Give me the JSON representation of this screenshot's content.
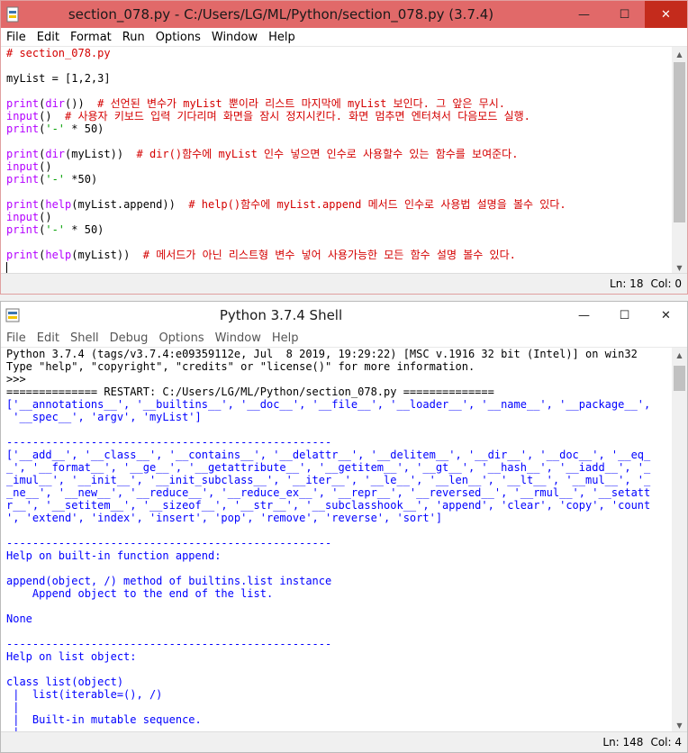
{
  "editor_window": {
    "title": "section_078.py - C:/Users/LG/ML/Python/section_078.py (3.7.4)",
    "menu": [
      "File",
      "Edit",
      "Format",
      "Run",
      "Options",
      "Window",
      "Help"
    ],
    "status": {
      "ln": "Ln: 18",
      "col": "Col: 0"
    },
    "lines": [
      [
        {
          "t": "# section_078.py",
          "c": "red"
        }
      ],
      [],
      [
        {
          "t": "myList = [1,2,3]",
          "c": "dflt"
        }
      ],
      [],
      [
        {
          "t": "print",
          "c": "kw"
        },
        {
          "t": "(",
          "c": "dflt"
        },
        {
          "t": "dir",
          "c": "kw"
        },
        {
          "t": "())  ",
          "c": "dflt"
        },
        {
          "t": "# 선언된 변수가 myList 뿐이라 리스트 마지막에 myList 보인다. 그 앞은 무시.",
          "c": "red"
        }
      ],
      [
        {
          "t": "input",
          "c": "kw"
        },
        {
          "t": "()  ",
          "c": "dflt"
        },
        {
          "t": "# 사용자 키보드 입력 기다리며 화면을 잠시 정지시킨다. 화면 멈추면 엔터쳐서 다음모드 실행.",
          "c": "red"
        }
      ],
      [
        {
          "t": "print",
          "c": "kw"
        },
        {
          "t": "(",
          "c": "dflt"
        },
        {
          "t": "'-'",
          "c": "grn"
        },
        {
          "t": " * 50)",
          "c": "dflt"
        }
      ],
      [],
      [
        {
          "t": "print",
          "c": "kw"
        },
        {
          "t": "(",
          "c": "dflt"
        },
        {
          "t": "dir",
          "c": "kw"
        },
        {
          "t": "(myList))  ",
          "c": "dflt"
        },
        {
          "t": "# dir()함수에 myList 인수 넣으면 인수로 사용할수 있는 함수를 보여준다.",
          "c": "red"
        }
      ],
      [
        {
          "t": "input",
          "c": "kw"
        },
        {
          "t": "()",
          "c": "dflt"
        }
      ],
      [
        {
          "t": "print",
          "c": "kw"
        },
        {
          "t": "(",
          "c": "dflt"
        },
        {
          "t": "'-'",
          "c": "grn"
        },
        {
          "t": " *50)",
          "c": "dflt"
        }
      ],
      [],
      [
        {
          "t": "print",
          "c": "kw"
        },
        {
          "t": "(",
          "c": "dflt"
        },
        {
          "t": "help",
          "c": "kw"
        },
        {
          "t": "(myList.append))  ",
          "c": "dflt"
        },
        {
          "t": "# help()함수에 myList.append 메서드 인수로 사용법 설명을 볼수 있다.",
          "c": "red"
        }
      ],
      [
        {
          "t": "input",
          "c": "kw"
        },
        {
          "t": "()",
          "c": "dflt"
        }
      ],
      [
        {
          "t": "print",
          "c": "kw"
        },
        {
          "t": "(",
          "c": "dflt"
        },
        {
          "t": "'-'",
          "c": "grn"
        },
        {
          "t": " * 50)",
          "c": "dflt"
        }
      ],
      [],
      [
        {
          "t": "print",
          "c": "kw"
        },
        {
          "t": "(",
          "c": "dflt"
        },
        {
          "t": "help",
          "c": "kw"
        },
        {
          "t": "(myList))  ",
          "c": "dflt"
        },
        {
          "t": "# 메서드가 아닌 리스트형 변수 넣어 사용가능한 모든 함수 설명 볼수 있다.",
          "c": "red"
        }
      ],
      [
        {
          "t": "",
          "c": "caret"
        }
      ]
    ]
  },
  "shell_window": {
    "title": "Python 3.7.4 Shell",
    "menu": [
      "File",
      "Edit",
      "Shell",
      "Debug",
      "Options",
      "Window",
      "Help"
    ],
    "status": {
      "ln": "Ln: 148",
      "col": "Col: 4"
    },
    "lines": [
      [
        {
          "t": "Python 3.7.4 (tags/v3.7.4:e09359112e, Jul  8 2019, 19:29:22) [MSC v.1916 32 bit (Intel)] on win32",
          "c": "dflt"
        }
      ],
      [
        {
          "t": "Type \"help\", \"copyright\", \"credits\" or \"license()\" for more information.",
          "c": "dflt"
        }
      ],
      [
        {
          "t": ">>> ",
          "c": "dflt"
        }
      ],
      [
        {
          "t": "============== RESTART: C:/Users/LG/ML/Python/section_078.py ==============",
          "c": "dflt"
        }
      ],
      [
        {
          "t": "['__annotations__', '__builtins__', '__doc__', '__file__', '__loader__', '__name__', '__package__',",
          "c": "blu"
        }
      ],
      [
        {
          "t": " '__spec__', 'argv', 'myList']",
          "c": "blu"
        }
      ],
      [],
      [
        {
          "t": "--------------------------------------------------",
          "c": "blu"
        }
      ],
      [
        {
          "t": "['__add__', '__class__', '__contains__', '__delattr__', '__delitem__', '__dir__', '__doc__', '__eq_",
          "c": "blu"
        }
      ],
      [
        {
          "t": "_', '__format__', '__ge__', '__getattribute__', '__getitem__', '__gt__', '__hash__', '__iadd__', '_",
          "c": "blu"
        }
      ],
      [
        {
          "t": "_imul__', '__init__', '__init_subclass__', '__iter__', '__le__', '__len__', '__lt__', '__mul__', '_",
          "c": "blu"
        }
      ],
      [
        {
          "t": "_ne__', '__new__', '__reduce__', '__reduce_ex__', '__repr__', '__reversed__', '__rmul__', '__setatt",
          "c": "blu"
        }
      ],
      [
        {
          "t": "r__', '__setitem__', '__sizeof__', '__str__', '__subclasshook__', 'append', 'clear', 'copy', 'count",
          "c": "blu"
        }
      ],
      [
        {
          "t": "', 'extend', 'index', 'insert', 'pop', 'remove', 'reverse', 'sort']",
          "c": "blu"
        }
      ],
      [],
      [
        {
          "t": "--------------------------------------------------",
          "c": "blu"
        }
      ],
      [
        {
          "t": "Help on built-in function append:",
          "c": "blu"
        }
      ],
      [],
      [
        {
          "t": "append(object, /) method of builtins.list instance",
          "c": "blu"
        }
      ],
      [
        {
          "t": "    Append object to the end of the list.",
          "c": "blu"
        }
      ],
      [],
      [
        {
          "t": "None",
          "c": "blu"
        }
      ],
      [],
      [
        {
          "t": "--------------------------------------------------",
          "c": "blu"
        }
      ],
      [
        {
          "t": "Help on list object:",
          "c": "blu"
        }
      ],
      [],
      [
        {
          "t": "class list(object)",
          "c": "blu"
        }
      ],
      [
        {
          "t": " |  list(iterable=(), /)",
          "c": "blu"
        }
      ],
      [
        {
          "t": " |  ",
          "c": "blu"
        }
      ],
      [
        {
          "t": " |  Built-in mutable sequence.",
          "c": "blu"
        }
      ],
      [
        {
          "t": " |  ",
          "c": "blu"
        }
      ]
    ]
  }
}
